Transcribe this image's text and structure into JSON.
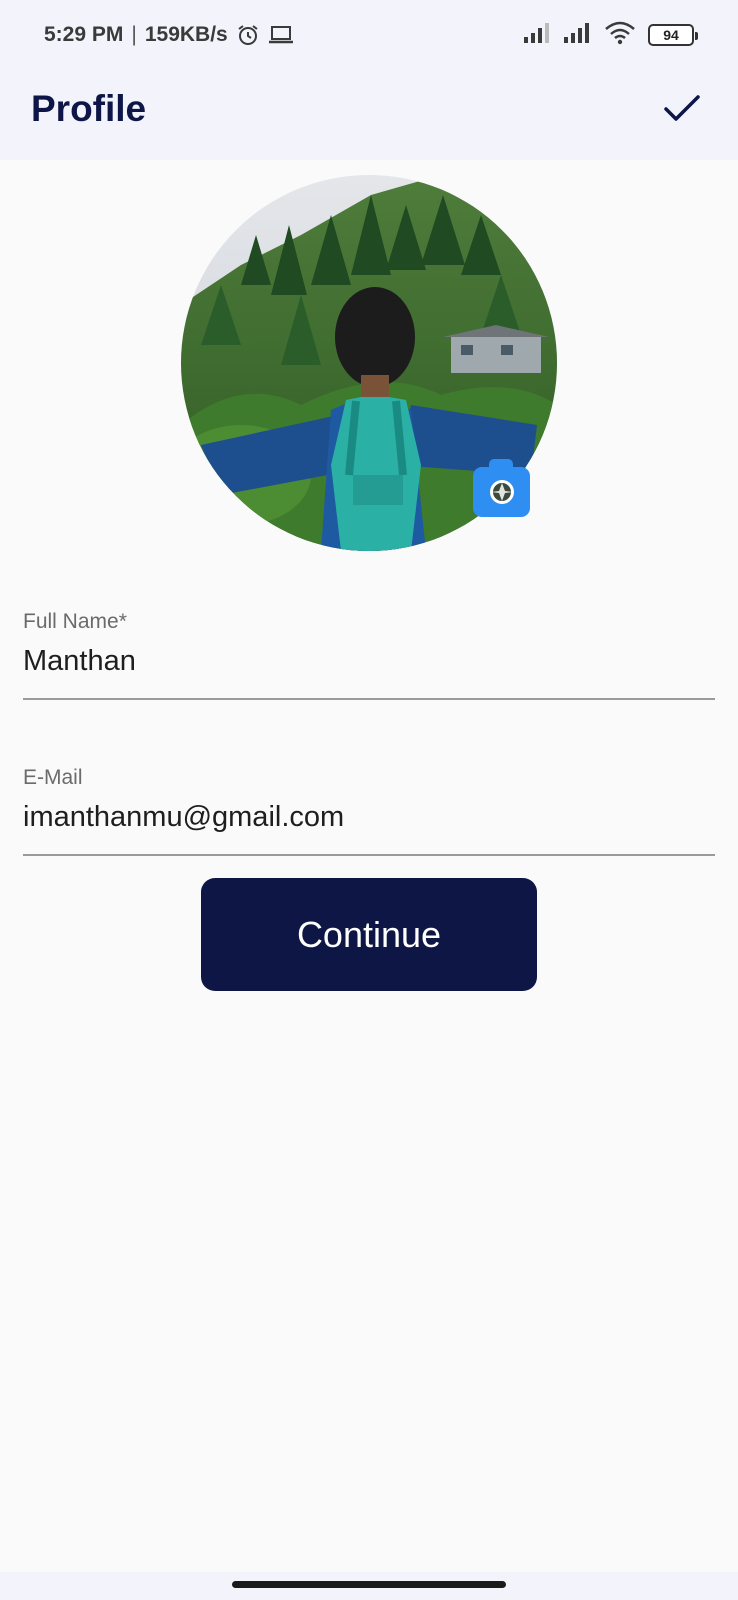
{
  "status_bar": {
    "time": "5:29 PM",
    "separator": "|",
    "network_speed": "159KB/s",
    "icons_left": [
      "alarm-icon",
      "laptop-icon"
    ],
    "icons_right": [
      "signal-icon",
      "signal-icon",
      "wifi-icon",
      "battery-icon"
    ],
    "battery_level": "94"
  },
  "app_bar": {
    "title": "Profile",
    "action_icon": "check-icon"
  },
  "profile": {
    "avatar_icon": "profile-photo",
    "edit_icon": "camera-icon"
  },
  "form": {
    "full_name": {
      "label": "Full Name*",
      "value": "Manthan"
    },
    "email": {
      "label": "E-Mail",
      "value": "imanthanmu@gmail.com"
    }
  },
  "continue_label": "Continue",
  "colors": {
    "primary": "#0e1646",
    "accent": "#2f8ef2",
    "app_bar_bg": "#f2f3fb",
    "background": "#fafafa"
  }
}
